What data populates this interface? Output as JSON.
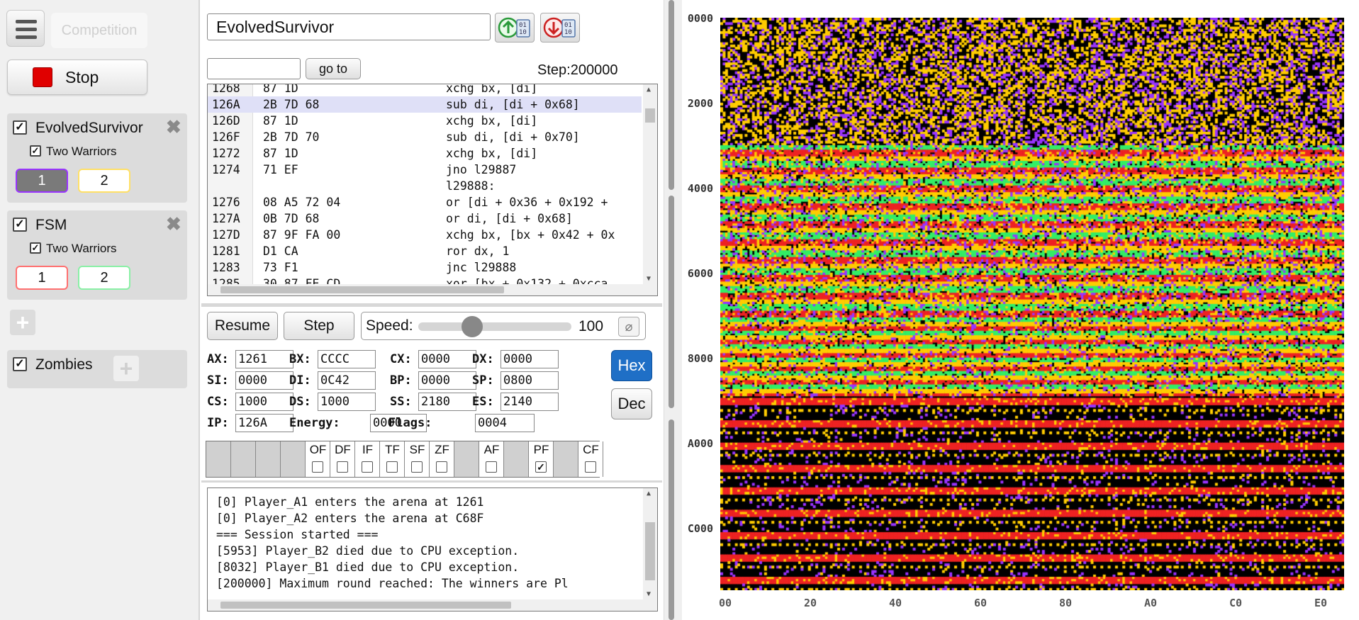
{
  "sidebar": {
    "competition_label": "Competition",
    "stop_label": "Stop",
    "warriors": [
      {
        "name": "EvolvedSurvivor",
        "checked": true,
        "two_warriors_label": "Two Warriors",
        "two_warriors_checked": true,
        "btn1": "1",
        "btn2": "2"
      },
      {
        "name": "FSM",
        "checked": true,
        "two_warriors_label": "Two Warriors",
        "two_warriors_checked": true,
        "btn1": "1",
        "btn2": "2"
      }
    ],
    "zombies_label": "Zombies",
    "zombies_checked": true
  },
  "debugger": {
    "warrior_name": "EvolvedSurvivor",
    "goto_label": "go to",
    "goto_value": "",
    "step_label": "Step:200000",
    "code_lines": [
      {
        "addr": "1268",
        "bytes": "87 1D",
        "asm": "xchg bx, [di]",
        "hl": false
      },
      {
        "addr": "126A",
        "bytes": "2B 7D 68",
        "asm": "sub di, [di + 0x68]",
        "hl": true
      },
      {
        "addr": "126D",
        "bytes": "87 1D",
        "asm": "xchg bx, [di]",
        "hl": false
      },
      {
        "addr": "126F",
        "bytes": "2B 7D 70",
        "asm": "sub di, [di + 0x70]",
        "hl": false
      },
      {
        "addr": "1272",
        "bytes": "87 1D",
        "asm": "xchg bx, [di]",
        "hl": false
      },
      {
        "addr": "1274",
        "bytes": "71 EF",
        "asm": "jno l29887",
        "hl": false
      },
      {
        "addr": "",
        "bytes": "",
        "asm": "l29888:",
        "hl": false
      },
      {
        "addr": "1276",
        "bytes": "08 A5 72 04",
        "asm": "or [di + 0x36 + 0x192 + ",
        "hl": false
      },
      {
        "addr": "127A",
        "bytes": "0B 7D 68",
        "asm": "or di, [di + 0x68]",
        "hl": false
      },
      {
        "addr": "127D",
        "bytes": "87 9F FA 00",
        "asm": "xchg bx, [bx + 0x42 + 0x",
        "hl": false
      },
      {
        "addr": "1281",
        "bytes": "D1 CA",
        "asm": "ror dx, 1",
        "hl": false
      },
      {
        "addr": "1283",
        "bytes": "73 F1",
        "asm": "jnc l29888",
        "hl": false
      },
      {
        "addr": "1285",
        "bytes": "30 87 FE CD",
        "asm": "xor [bx + 0x132 + 0xcca",
        "hl": false
      }
    ],
    "resume_label": "Resume",
    "step_btn_label": "Step",
    "speed_label": "Speed:",
    "speed_value": "100",
    "speed_fraction": 0.33,
    "registers": {
      "AX": "1261",
      "BX": "CCCC",
      "CX": "0000",
      "DX": "0000",
      "SI": "0000",
      "DI": "0C42",
      "BP": "0000",
      "SP": "0800",
      "CS": "1000",
      "DS": "1000",
      "SS": "2180",
      "ES": "2140",
      "IP": "126A",
      "Energy": "0000",
      "Flags": "0004"
    },
    "hex_label": "Hex",
    "dec_label": "Dec",
    "flags": [
      {
        "name": "OF",
        "checked": false
      },
      {
        "name": "DF",
        "checked": false
      },
      {
        "name": "IF",
        "checked": false
      },
      {
        "name": "TF",
        "checked": false
      },
      {
        "name": "SF",
        "checked": false
      },
      {
        "name": "ZF",
        "checked": false
      },
      {
        "name": "AF",
        "checked": false
      },
      {
        "name": "PF",
        "checked": true
      },
      {
        "name": "CF",
        "checked": false
      }
    ],
    "log_lines": [
      "[0] Player_A1 enters the arena at 1261",
      "[0] Player_A2 enters the arena at C68F",
      "=== Session started ===",
      "[5953] Player_B2 died due to CPU exception.",
      "[8032] Player_B1 died due to CPU exception.",
      "[200000] Maximum round reached: The winners are Pl"
    ]
  },
  "memory_map": {
    "y_labels": [
      "0000",
      "2000",
      "4000",
      "6000",
      "8000",
      "A000",
      "C000"
    ],
    "x_labels": [
      "00",
      "20",
      "40",
      "60",
      "80",
      "A0",
      "C0",
      "E0"
    ],
    "colors": {
      "empty": "#000000",
      "player_a1": "#ffcc00",
      "player_a2": "#9933ff",
      "player_b1": "#33ee66",
      "player_b2": "#ee2222",
      "accent_hex": "#1f6fc6"
    }
  }
}
